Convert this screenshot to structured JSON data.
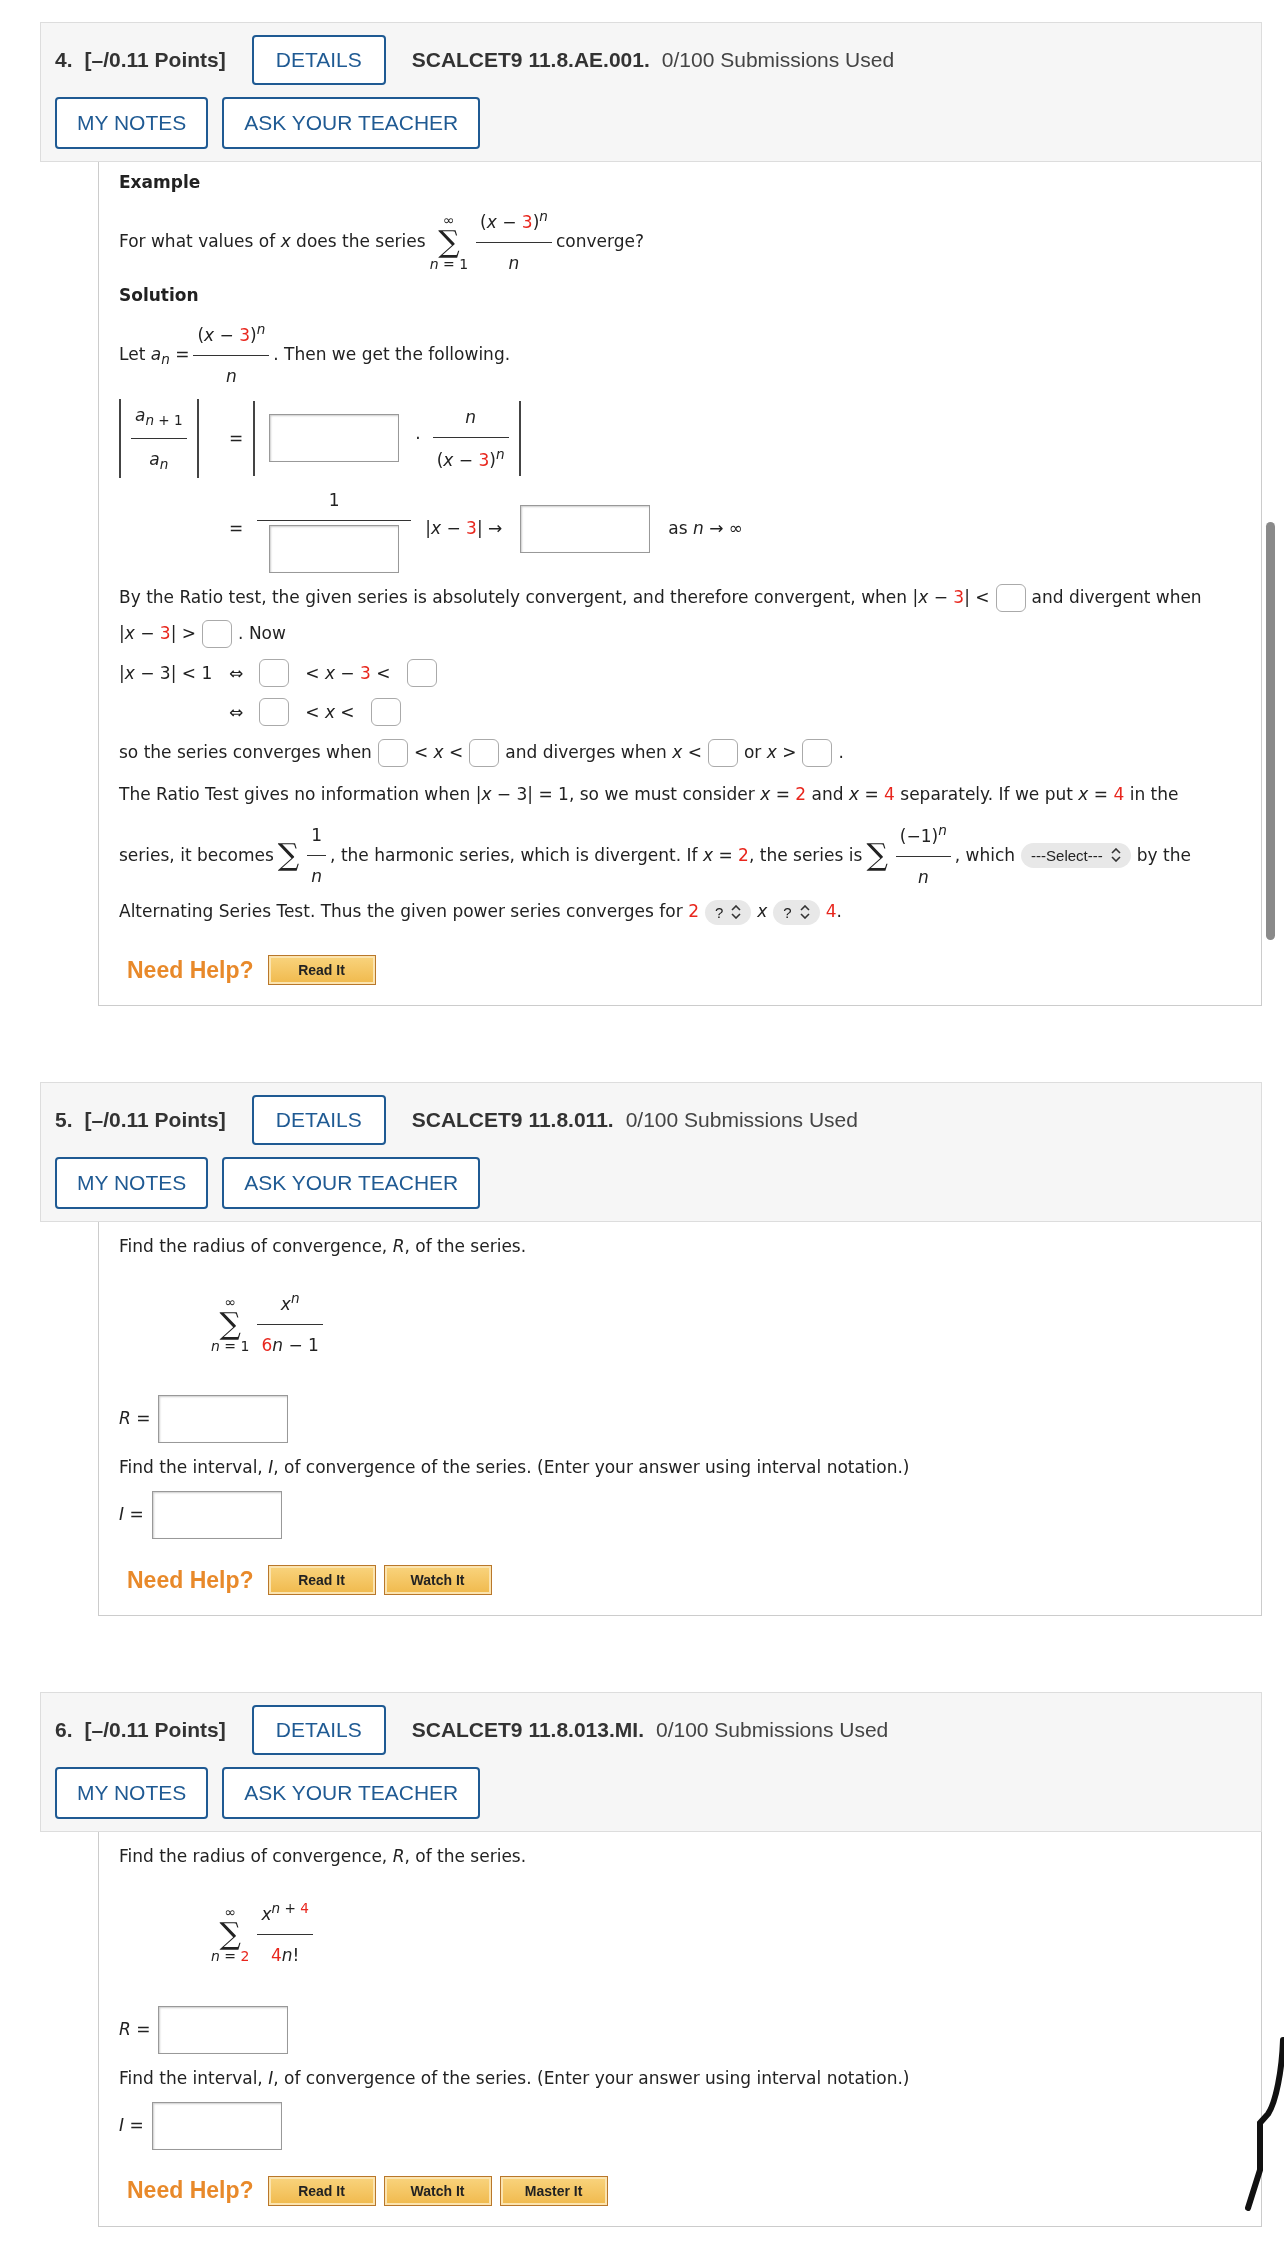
{
  "questions": [
    {
      "number": "4.",
      "points": "[–/0.11 Points]",
      "details": "DETAILS",
      "code": "SCALCET9 11.8.AE.001.",
      "submissions": "0/100 Submissions Used",
      "note_buttons": [
        "MY NOTES",
        "ASK YOUR TEACHER"
      ],
      "lines": [
        {
          "kind": "heading",
          "text": "Example"
        },
        {
          "kind": "flow",
          "items": [
            {
              "kind": "text",
              "segs": [
                {
                  "kind": "text",
                  "t": "For what values of *x* does the series"
                }
              ]
            },
            {
              "kind": "sum",
              "symbol": "∑",
              "top": "∞",
              "bottom": [
                {
                  "kind": "text",
                  "t": "*n* = 1"
                }
              ]
            },
            {
              "kind": "frac",
              "num": [
                {
                  "kind": "text",
                  "segs": [
                    {
                      "kind": "text",
                      "t": "(*x* − "
                    },
                    {
                      "kind": "red",
                      "t": "3"
                    },
                    {
                      "kind": "text",
                      "t": ")"
                    },
                    {
                      "kind": "sup",
                      "t": "*n*"
                    }
                  ]
                }
              ],
              "den": [
                {
                  "kind": "text",
                  "segs": [
                    {
                      "kind": "text",
                      "t": "*n*"
                    }
                  ]
                }
              ]
            },
            {
              "kind": "text",
              "segs": [
                {
                  "kind": "text",
                  "t": "converge?"
                }
              ]
            }
          ]
        },
        {
          "kind": "heading",
          "text": "Solution"
        },
        {
          "kind": "flow",
          "items": [
            {
              "kind": "text",
              "segs": [
                {
                  "kind": "text",
                  "t": "Let *a*"
                },
                {
                  "kind": "sub",
                  "t": "*n*"
                },
                {
                  "kind": "text",
                  "t": " ="
                }
              ]
            },
            {
              "kind": "frac",
              "num": [
                {
                  "kind": "text",
                  "segs": [
                    {
                      "kind": "text",
                      "t": "(*x* − "
                    },
                    {
                      "kind": "red",
                      "t": "3"
                    },
                    {
                      "kind": "text",
                      "t": ")"
                    },
                    {
                      "kind": "sup",
                      "t": "*n*"
                    }
                  ]
                }
              ],
              "den": [
                {
                  "kind": "text",
                  "segs": [
                    {
                      "kind": "text",
                      "t": "*n*"
                    }
                  ]
                }
              ]
            },
            {
              "kind": "text",
              "segs": [
                {
                  "kind": "text",
                  "t": ". Then we get the following."
                }
              ]
            }
          ]
        },
        {
          "kind": "aligned",
          "lead": [
            {
              "kind": "abs",
              "items": [
                {
                  "kind": "frac",
                  "num": [
                    {
                      "kind": "text",
                      "segs": [
                        {
                          "kind": "text",
                          "t": "*a*"
                        },
                        {
                          "kind": "sub",
                          "t": "*n* + 1"
                        }
                      ]
                    }
                  ],
                  "den": [
                    {
                      "kind": "text",
                      "segs": [
                        {
                          "kind": "text",
                          "t": "*a*"
                        },
                        {
                          "kind": "sub",
                          "t": "*n*"
                        }
                      ]
                    }
                  ]
                }
              ]
            }
          ],
          "items": [
            {
              "kind": "text",
              "segs": [
                {
                  "kind": "text",
                  "t": "="
                }
              ]
            },
            {
              "kind": "abs",
              "items": [
                {
                  "kind": "wide-blank"
                },
                {
                  "kind": "text",
                  "segs": [
                    {
                      "kind": "text",
                      "t": "·"
                    }
                  ]
                },
                {
                  "kind": "frac",
                  "num": [
                    {
                      "kind": "text",
                      "segs": [
                        {
                          "kind": "text",
                          "t": "*n*"
                        }
                      ]
                    }
                  ],
                  "den": [
                    {
                      "kind": "text",
                      "segs": [
                        {
                          "kind": "text",
                          "t": "(*x* − "
                        },
                        {
                          "kind": "red",
                          "t": "3"
                        },
                        {
                          "kind": "text",
                          "t": ")"
                        },
                        {
                          "kind": "sup",
                          "t": "*n*"
                        }
                      ]
                    }
                  ]
                }
              ]
            }
          ]
        },
        {
          "kind": "aligned",
          "items": [
            {
              "kind": "text",
              "segs": [
                {
                  "kind": "text",
                  "t": "="
                }
              ]
            },
            {
              "kind": "frac",
              "num": [
                {
                  "kind": "text",
                  "segs": [
                    {
                      "kind": "text",
                      "t": "1"
                    }
                  ]
                }
              ],
              "den": [
                {
                  "kind": "wide-blank"
                }
              ]
            },
            {
              "kind": "text",
              "segs": [
                {
                  "kind": "text",
                  "t": "|*x* − "
                },
                {
                  "kind": "red",
                  "t": "3"
                },
                {
                  "kind": "text",
                  "t": "| →"
                }
              ]
            },
            {
              "kind": "wide-blank"
            },
            {
              "kind": "text",
              "segs": [
                {
                  "kind": "text",
                  "t": "as *n* → ∞"
                }
              ]
            }
          ]
        },
        {
          "kind": "tight",
          "items": [
            {
              "kind": "text",
              "segs": [
                {
                  "kind": "text",
                  "t": "By the Ratio test, the given series is absolutely convergent, and therefore convergent, when |*x* − "
                },
                {
                  "kind": "red",
                  "t": "3"
                },
                {
                  "kind": "text",
                  "t": "| <"
                }
              ]
            },
            {
              "kind": "blank"
            },
            {
              "kind": "text",
              "segs": [
                {
                  "kind": "text",
                  "t": "and divergent when"
                }
              ]
            }
          ]
        },
        {
          "kind": "flow",
          "items": [
            {
              "kind": "text",
              "segs": [
                {
                  "kind": "text",
                  "t": "|*x* − "
                },
                {
                  "kind": "red",
                  "t": "3"
                },
                {
                  "kind": "text",
                  "t": "| >"
                }
              ]
            },
            {
              "kind": "blank"
            },
            {
              "kind": "text",
              "segs": [
                {
                  "kind": "text",
                  "t": ". Now"
                }
              ]
            }
          ]
        },
        {
          "kind": "aligned",
          "lead": [
            {
              "kind": "text",
              "segs": [
                {
                  "kind": "text",
                  "t": "|*x* − 3| < 1"
                }
              ]
            }
          ],
          "items": [
            {
              "kind": "text",
              "segs": [
                {
                  "kind": "text",
                  "t": "⇔"
                }
              ]
            },
            {
              "kind": "blank"
            },
            {
              "kind": "text",
              "segs": [
                {
                  "kind": "text",
                  "t": "< *x* − "
                },
                {
                  "kind": "red",
                  "t": "3"
                },
                {
                  "kind": "text",
                  "t": " <"
                }
              ]
            },
            {
              "kind": "blank"
            }
          ]
        },
        {
          "kind": "aligned",
          "items": [
            {
              "kind": "text",
              "segs": [
                {
                  "kind": "text",
                  "t": "⇔"
                }
              ]
            },
            {
              "kind": "blank"
            },
            {
              "kind": "text",
              "segs": [
                {
                  "kind": "text",
                  "t": "< *x* <"
                }
              ]
            },
            {
              "kind": "blank"
            }
          ]
        },
        {
          "kind": "flow",
          "items": [
            {
              "kind": "text",
              "segs": [
                {
                  "kind": "text",
                  "t": "so the series converges when"
                }
              ]
            },
            {
              "kind": "blank"
            },
            {
              "kind": "text",
              "segs": [
                {
                  "kind": "text",
                  "t": "< *x* <"
                }
              ]
            },
            {
              "kind": "blank"
            },
            {
              "kind": "text",
              "segs": [
                {
                  "kind": "text",
                  "t": "and diverges when *x* <"
                }
              ]
            },
            {
              "kind": "blank"
            },
            {
              "kind": "text",
              "segs": [
                {
                  "kind": "text",
                  "t": "or *x* >"
                }
              ]
            },
            {
              "kind": "blank"
            },
            {
              "kind": "text",
              "segs": [
                {
                  "kind": "text",
                  "t": "."
                }
              ]
            }
          ]
        },
        {
          "kind": "flow",
          "items": [
            {
              "kind": "text",
              "segs": [
                {
                  "kind": "text",
                  "t": "The Ratio Test gives no information when |*x* − 3| = 1, so we must consider *x* = "
                },
                {
                  "kind": "red",
                  "t": "2"
                },
                {
                  "kind": "text",
                  "t": " and *x* = "
                },
                {
                  "kind": "red",
                  "t": "4"
                },
                {
                  "kind": "text",
                  "t": " separately. If we put *x* = "
                },
                {
                  "kind": "red",
                  "t": "4"
                },
                {
                  "kind": "text",
                  "t": " in the"
                }
              ]
            }
          ]
        },
        {
          "kind": "tight",
          "items": [
            {
              "kind": "text",
              "segs": [
                {
                  "kind": "text",
                  "t": "series, it becomes"
                }
              ]
            },
            {
              "kind": "sum",
              "symbol": "∑"
            },
            {
              "kind": "frac",
              "num": [
                {
                  "kind": "text",
                  "segs": [
                    {
                      "kind": "text",
                      "t": "1"
                    }
                  ]
                }
              ],
              "den": [
                {
                  "kind": "text",
                  "segs": [
                    {
                      "kind": "text",
                      "t": "*n*"
                    }
                  ]
                }
              ]
            },
            {
              "kind": "text",
              "segs": [
                {
                  "kind": "text",
                  "t": ", the harmonic series, which is divergent. If *x* = "
                },
                {
                  "kind": "red",
                  "t": "2"
                },
                {
                  "kind": "text",
                  "t": ", the series is"
                }
              ]
            },
            {
              "kind": "sum",
              "symbol": "∑"
            },
            {
              "kind": "frac",
              "num": [
                {
                  "kind": "text",
                  "segs": [
                    {
                      "kind": "text",
                      "t": "(−1)"
                    },
                    {
                      "kind": "sup",
                      "t": "*n*"
                    }
                  ]
                }
              ],
              "den": [
                {
                  "kind": "text",
                  "segs": [
                    {
                      "kind": "text",
                      "t": "*n*"
                    }
                  ]
                }
              ]
            },
            {
              "kind": "text",
              "segs": [
                {
                  "kind": "text",
                  "t": ", which"
                }
              ]
            },
            {
              "kind": "select",
              "label": "---Select---"
            },
            {
              "kind": "text",
              "segs": [
                {
                  "kind": "text",
                  "t": "by the"
                }
              ]
            }
          ]
        },
        {
          "kind": "flow",
          "items": [
            {
              "kind": "text",
              "segs": [
                {
                  "kind": "text",
                  "t": "Alternating Series Test. Thus the given power series converges for "
                },
                {
                  "kind": "red",
                  "t": "2"
                }
              ]
            },
            {
              "kind": "select",
              "label": "?"
            },
            {
              "kind": "text",
              "segs": [
                {
                  "kind": "text",
                  "t": "*x*"
                }
              ]
            },
            {
              "kind": "select",
              "label": "?"
            },
            {
              "kind": "text",
              "segs": [
                {
                  "kind": "red",
                  "t": "4"
                },
                {
                  "kind": "text",
                  "t": "."
                }
              ]
            }
          ]
        }
      ],
      "help": {
        "label": "Need Help?",
        "buttons": [
          "Read It"
        ]
      }
    },
    {
      "number": "5.",
      "points": "[–/0.11 Points]",
      "details": "DETAILS",
      "code": "SCALCET9 11.8.011.",
      "submissions": "0/100 Submissions Used",
      "note_buttons": [
        "MY NOTES",
        "ASK YOUR TEACHER"
      ],
      "lines": [
        {
          "kind": "flow",
          "items": [
            {
              "kind": "text",
              "segs": [
                {
                  "kind": "text",
                  "t": "Find the radius of convergence, *R*, of the series."
                }
              ]
            }
          ]
        },
        {
          "kind": "display",
          "items": [
            {
              "kind": "sum",
              "symbol": "∑",
              "top": "∞",
              "bottom": [
                {
                  "kind": "text",
                  "t": "*n* = 1"
                }
              ]
            },
            {
              "kind": "frac",
              "num": [
                {
                  "kind": "text",
                  "segs": [
                    {
                      "kind": "text",
                      "t": "*x*"
                    },
                    {
                      "kind": "sup",
                      "t": "*n*"
                    }
                  ]
                }
              ],
              "den": [
                {
                  "kind": "text",
                  "segs": [
                    {
                      "kind": "red",
                      "t": "6"
                    },
                    {
                      "kind": "text",
                      "t": "*n* − 1"
                    }
                  ]
                }
              ]
            }
          ]
        },
        {
          "kind": "flow",
          "items": [
            {
              "kind": "text",
              "segs": [
                {
                  "kind": "text",
                  "t": "*R* ="
                }
              ]
            },
            {
              "kind": "wide-blank"
            }
          ]
        },
        {
          "kind": "flow",
          "items": [
            {
              "kind": "text",
              "segs": [
                {
                  "kind": "text",
                  "t": "Find the interval, *I*, of convergence of the series. (Enter your answer using interval notation.)"
                }
              ]
            }
          ]
        },
        {
          "kind": "flow",
          "items": [
            {
              "kind": "text",
              "segs": [
                {
                  "kind": "text",
                  "t": "*I* ="
                }
              ]
            },
            {
              "kind": "wide-blank"
            }
          ]
        }
      ],
      "help": {
        "label": "Need Help?",
        "buttons": [
          "Read It",
          "Watch It"
        ]
      }
    },
    {
      "number": "6.",
      "points": "[–/0.11 Points]",
      "details": "DETAILS",
      "code": "SCALCET9 11.8.013.MI.",
      "submissions": "0/100 Submissions Used",
      "note_buttons": [
        "MY NOTES",
        "ASK YOUR TEACHER"
      ],
      "lines": [
        {
          "kind": "flow",
          "items": [
            {
              "kind": "text",
              "segs": [
                {
                  "kind": "text",
                  "t": "Find the radius of convergence, *R*, of the series."
                }
              ]
            }
          ]
        },
        {
          "kind": "display",
          "items": [
            {
              "kind": "sum",
              "symbol": "∑",
              "top": "∞",
              "bottom": [
                {
                  "kind": "text",
                  "t": "*n* = "
                },
                {
                  "kind": "red",
                  "t": "2"
                }
              ]
            },
            {
              "kind": "frac",
              "num": [
                {
                  "kind": "text",
                  "segs": [
                    {
                      "kind": "text",
                      "t": "*x*"
                    },
                    {
                      "kind": "sup",
                      "t": "*n* + "
                    },
                    {
                      "kind": "sup-red",
                      "t": "4"
                    }
                  ]
                }
              ],
              "den": [
                {
                  "kind": "text",
                  "segs": [
                    {
                      "kind": "red",
                      "t": "4"
                    },
                    {
                      "kind": "text",
                      "t": "*n*!"
                    }
                  ]
                }
              ]
            }
          ]
        },
        {
          "kind": "flow",
          "items": [
            {
              "kind": "text",
              "segs": [
                {
                  "kind": "text",
                  "t": "*R* ="
                }
              ]
            },
            {
              "kind": "wide-blank"
            }
          ]
        },
        {
          "kind": "flow",
          "items": [
            {
              "kind": "text",
              "segs": [
                {
                  "kind": "text",
                  "t": "Find the interval, *I*, of convergence of the series. (Enter your answer using interval notation.)"
                }
              ]
            }
          ]
        },
        {
          "kind": "flow",
          "items": [
            {
              "kind": "text",
              "segs": [
                {
                  "kind": "text",
                  "t": "*I* ="
                }
              ]
            },
            {
              "kind": "wide-blank"
            }
          ]
        }
      ],
      "help": {
        "label": "Need Help?",
        "buttons": [
          "Read It",
          "Watch It",
          "Master It"
        ]
      }
    }
  ]
}
